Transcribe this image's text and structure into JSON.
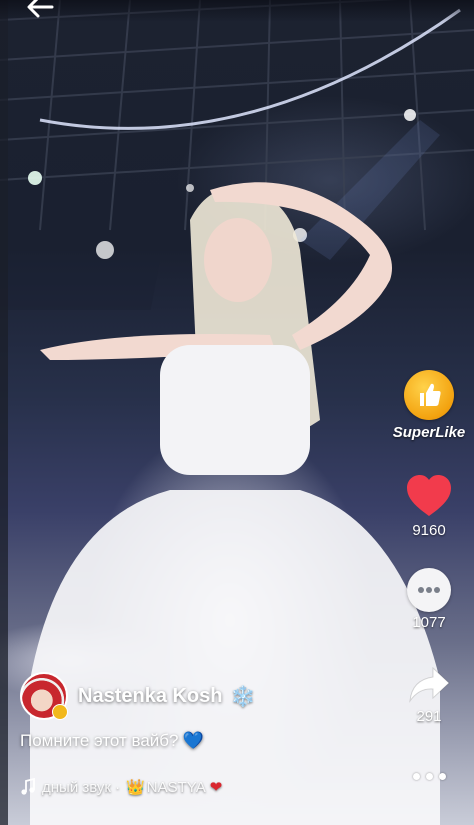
{
  "nav": {
    "back_icon": "arrow-left-icon"
  },
  "rail": {
    "superlike": {
      "label": "SuperLike",
      "icon": "thumbs-up-icon",
      "color": "#f3a20f"
    },
    "like": {
      "count": "9160",
      "icon": "heart-icon",
      "color": "#f23b4c"
    },
    "comments": {
      "count": "1077",
      "icon": "comment-bubble-icon"
    },
    "share": {
      "count": "291",
      "icon": "share-arrow-icon"
    },
    "more": {
      "icon": "more-dots-icon"
    }
  },
  "post": {
    "author": {
      "name": "Nastenka Kosh",
      "emoji": "❄️"
    },
    "caption": {
      "text": "Помните этот вайб?",
      "emoji": "💙"
    },
    "sound": {
      "prefix": "дный звук ·",
      "user": "NASTYA",
      "crown": "👑",
      "heart": "❤"
    }
  }
}
